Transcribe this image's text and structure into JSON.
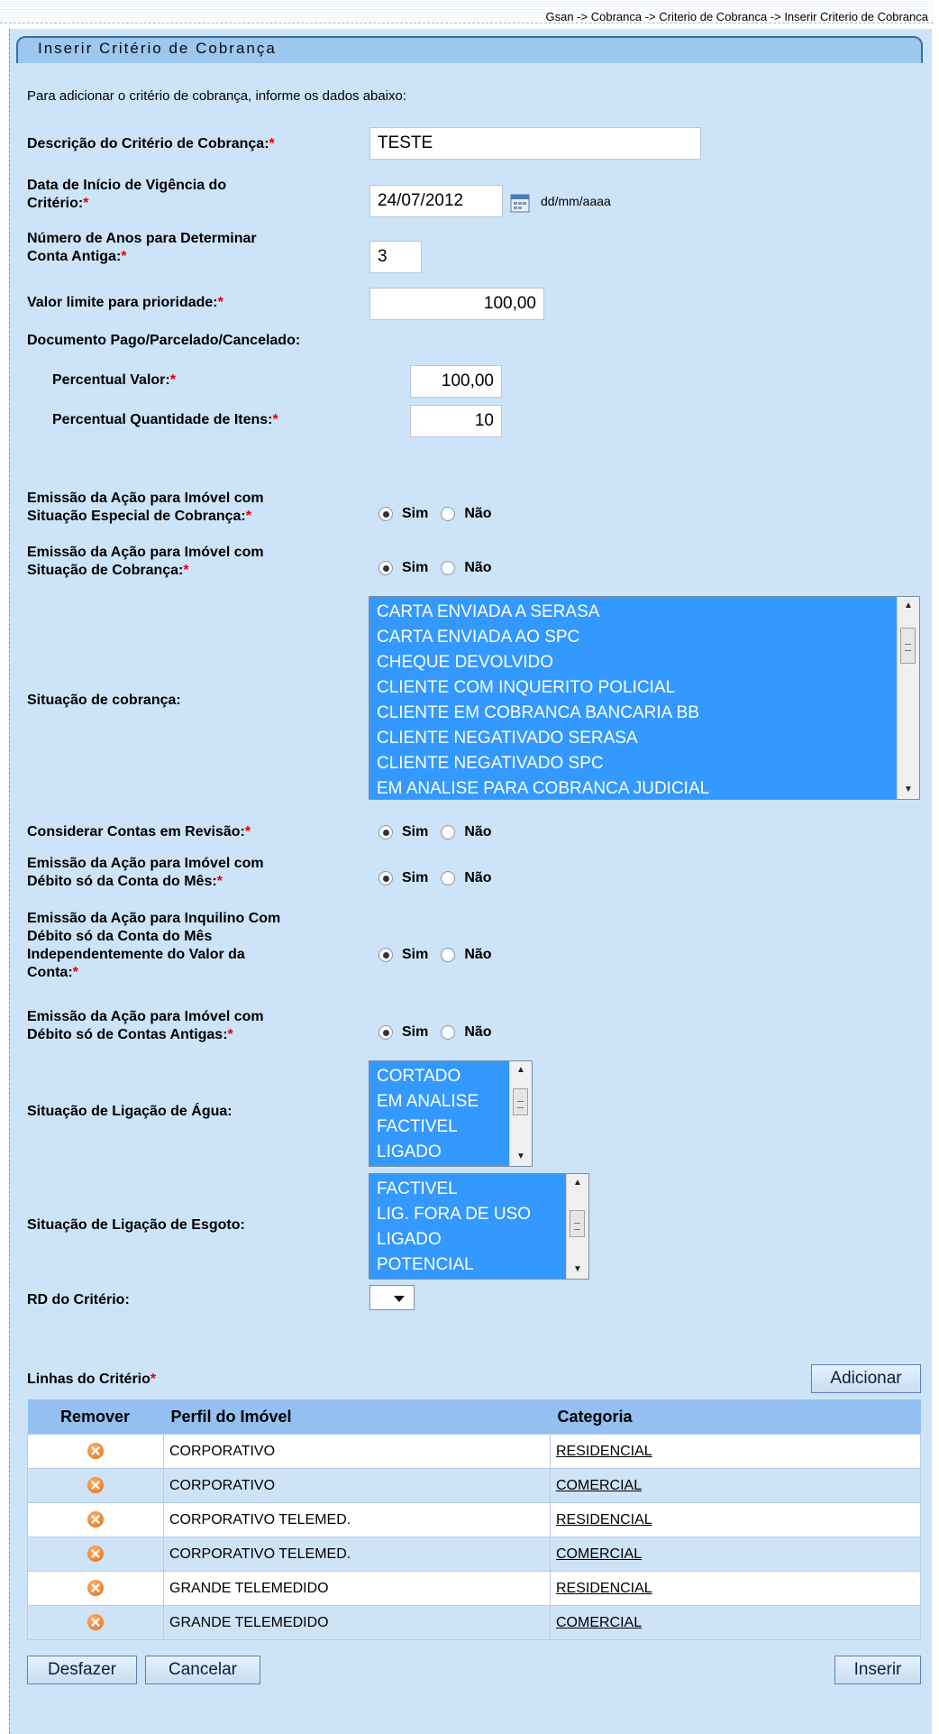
{
  "breadcrumb": "Gsan -> Cobranca -> Criterio de Cobranca -> Inserir Criterio de Cobranca",
  "title": "Inserir Critério de Cobrança",
  "intro": "Para adicionar o critério de cobrança, informe os dados abaixo:",
  "form": {
    "descricao_label": "Descrição do Critério de Cobrança:",
    "descricao_value": "TESTE",
    "data_label_1": "Data de Início de Vigência do",
    "data_label_2": "Critério:",
    "data_value": "24/07/2012",
    "data_format": "dd/mm/aaaa",
    "anos_label_1": "Número de Anos para Determinar",
    "anos_label_2": "Conta Antiga:",
    "anos_value": "3",
    "valor_limite_label": "Valor limite para prioridade:",
    "valor_limite_value": "100,00",
    "documento_label": "Documento Pago/Parcelado/Cancelado:",
    "percentual_valor_label": "Percentual Valor:",
    "percentual_valor_value": "100,00",
    "percentual_qtd_label": "Percentual Quantidade de Itens:",
    "percentual_qtd_value": "10",
    "req_mark": "*",
    "sim": "Sim",
    "nao": "Não",
    "especial_label_1": "Emissão da Ação para Imóvel com",
    "especial_label_2": "Situação Especial de Cobrança:",
    "situacao_label_1": "Emissão da Ação para Imóvel com",
    "situacao_label_2": "Situação de Cobrança:",
    "situacao_cobranca_label": "Situação de cobrança:",
    "situacao_cobranca_options": [
      "CARTA ENVIADA A SERASA",
      "CARTA ENVIADA AO SPC",
      "CHEQUE DEVOLVIDO",
      "CLIENTE COM INQUERITO POLICIAL",
      "CLIENTE EM COBRANCA BANCARIA BB",
      "CLIENTE NEGATIVADO SERASA",
      "CLIENTE NEGATIVADO SPC",
      "EM ANALISE PARA COBRANCA JUDICIAL"
    ],
    "revisao_label": "Considerar Contas em Revisão:",
    "mes_label_1": "Emissão da Ação para Imóvel com",
    "mes_label_2": "Débito só da Conta do Mês:",
    "inquilino_label_1": "Emissão da Ação para Inquilino Com",
    "inquilino_label_2": "Débito só da Conta do Mês",
    "inquilino_label_3": "Independentemente do Valor da",
    "inquilino_label_4": "Conta:",
    "antigas_label_1": "Emissão da Ação para Imóvel com",
    "antigas_label_2": "Débito só de Contas Antigas:",
    "agua_label": "Situação de Ligação de Água:",
    "agua_options": [
      "CORTADO",
      "EM ANALISE",
      "FACTIVEL",
      "LIGADO"
    ],
    "esgoto_label": "Situação de Ligação de Esgoto:",
    "esgoto_options": [
      "FACTIVEL",
      "LIG. FORA DE USO",
      "LIGADO",
      "POTENCIAL"
    ],
    "rd_label": "RD do Critério:",
    "rd_value": ""
  },
  "linhas": {
    "title": "Linhas do Critério",
    "add_button": "Adicionar",
    "headers": [
      "Remover",
      "Perfil do Imóvel",
      "Categoria"
    ],
    "rows": [
      {
        "perfil": "CORPORATIVO",
        "categoria": "RESIDENCIAL"
      },
      {
        "perfil": "CORPORATIVO",
        "categoria": "COMERCIAL"
      },
      {
        "perfil": "CORPORATIVO TELEMED.",
        "categoria": "RESIDENCIAL"
      },
      {
        "perfil": "CORPORATIVO TELEMED.",
        "categoria": "COMERCIAL"
      },
      {
        "perfil": "GRANDE TELEMEDIDO",
        "categoria": "RESIDENCIAL"
      },
      {
        "perfil": "GRANDE TELEMEDIDO",
        "categoria": "COMERCIAL"
      }
    ]
  },
  "buttons": {
    "desfazer": "Desfazer",
    "cancelar": "Cancelar",
    "inserir": "Inserir"
  },
  "icons": {
    "calendar": "calendar-icon",
    "remove": "remove-icon"
  }
}
